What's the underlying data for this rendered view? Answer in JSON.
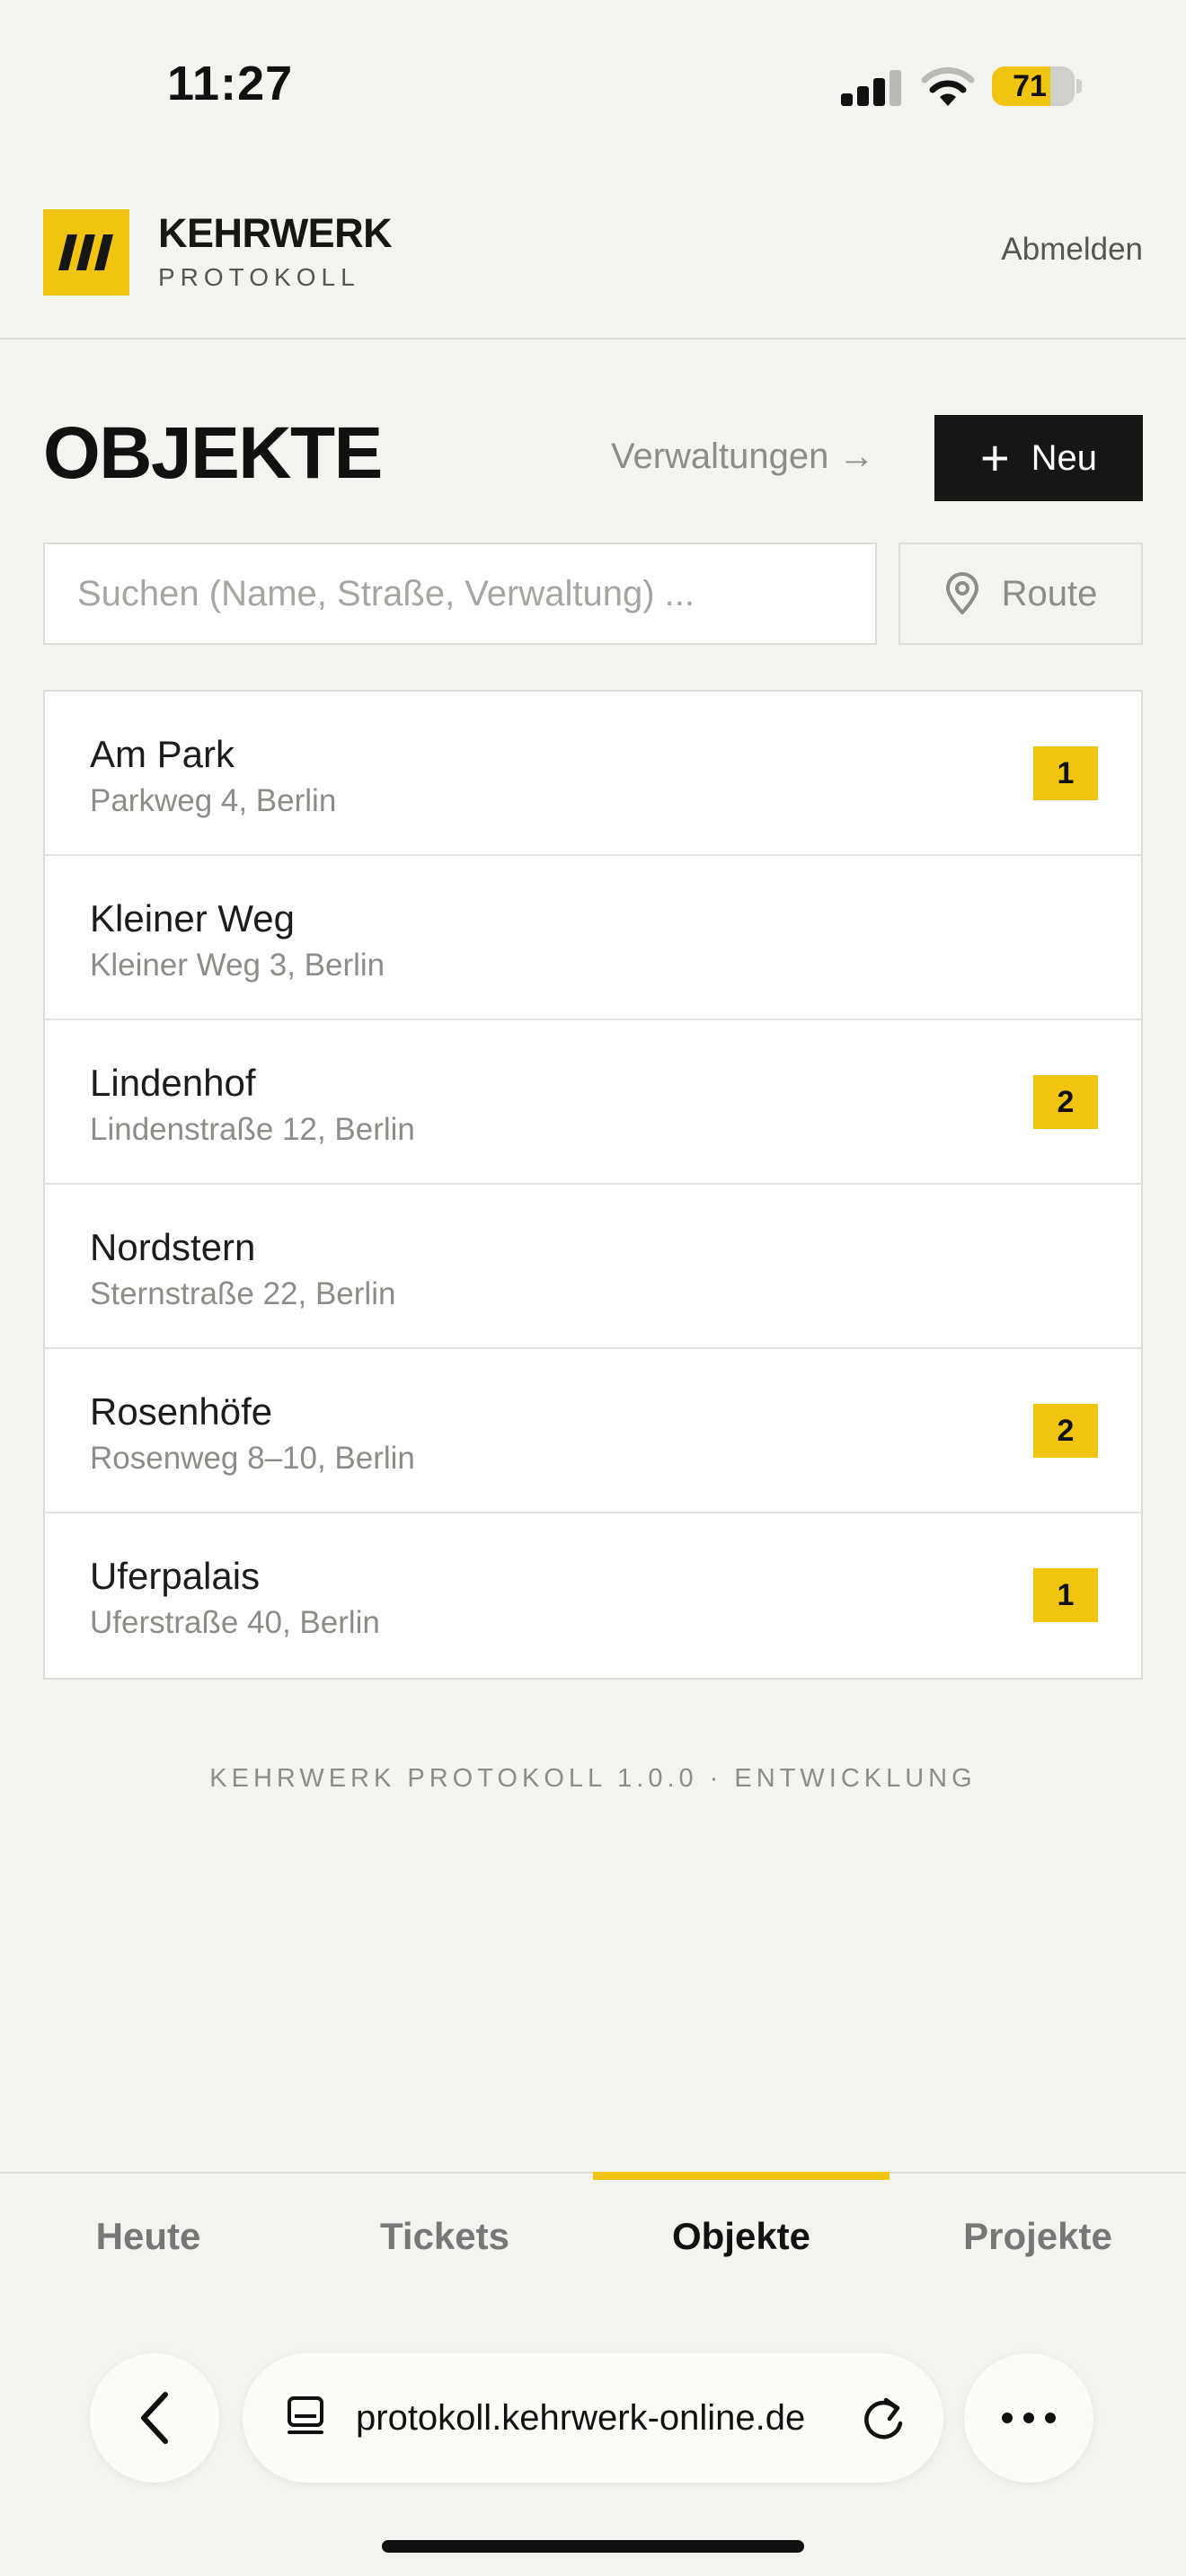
{
  "status_bar": {
    "time": "11:27",
    "battery_level": "71"
  },
  "header": {
    "brand_name": "KEHRWERK",
    "brand_sub": "PROTOKOLL",
    "logout_label": "Abmelden"
  },
  "page": {
    "title": "OBJEKTE",
    "verwaltungen_link": "Verwaltungen →",
    "new_label": "Neu"
  },
  "search": {
    "placeholder": "Suchen (Name, Straße, Verwaltung) ...",
    "value": ""
  },
  "route_label": "Route",
  "objects": [
    {
      "name": "Am Park",
      "address": "Parkweg 4, Berlin",
      "badge": "1"
    },
    {
      "name": "Kleiner Weg",
      "address": "Kleiner Weg 3, Berlin",
      "badge": ""
    },
    {
      "name": "Lindenhof",
      "address": "Lindenstraße 12, Berlin",
      "badge": "2"
    },
    {
      "name": "Nordstern",
      "address": "Sternstraße 22, Berlin",
      "badge": ""
    },
    {
      "name": "Rosenhöfe",
      "address": "Rosenweg 8–10, Berlin",
      "badge": "2"
    },
    {
      "name": "Uferpalais",
      "address": "Uferstraße 40, Berlin",
      "badge": "1"
    }
  ],
  "footer": {
    "version": "KEHRWERK PROTOKOLL 1.0.0 · ENTWICKLUNG"
  },
  "tabs": [
    {
      "label": "Heute",
      "active": false
    },
    {
      "label": "Tickets",
      "active": false
    },
    {
      "label": "Objekte",
      "active": true
    },
    {
      "label": "Projekte",
      "active": false
    }
  ],
  "browser": {
    "url": "protokoll.kehrwerk-online.de"
  },
  "colors": {
    "accent": "#f1c40f",
    "dark": "#161614",
    "background": "#f3f3ef"
  }
}
